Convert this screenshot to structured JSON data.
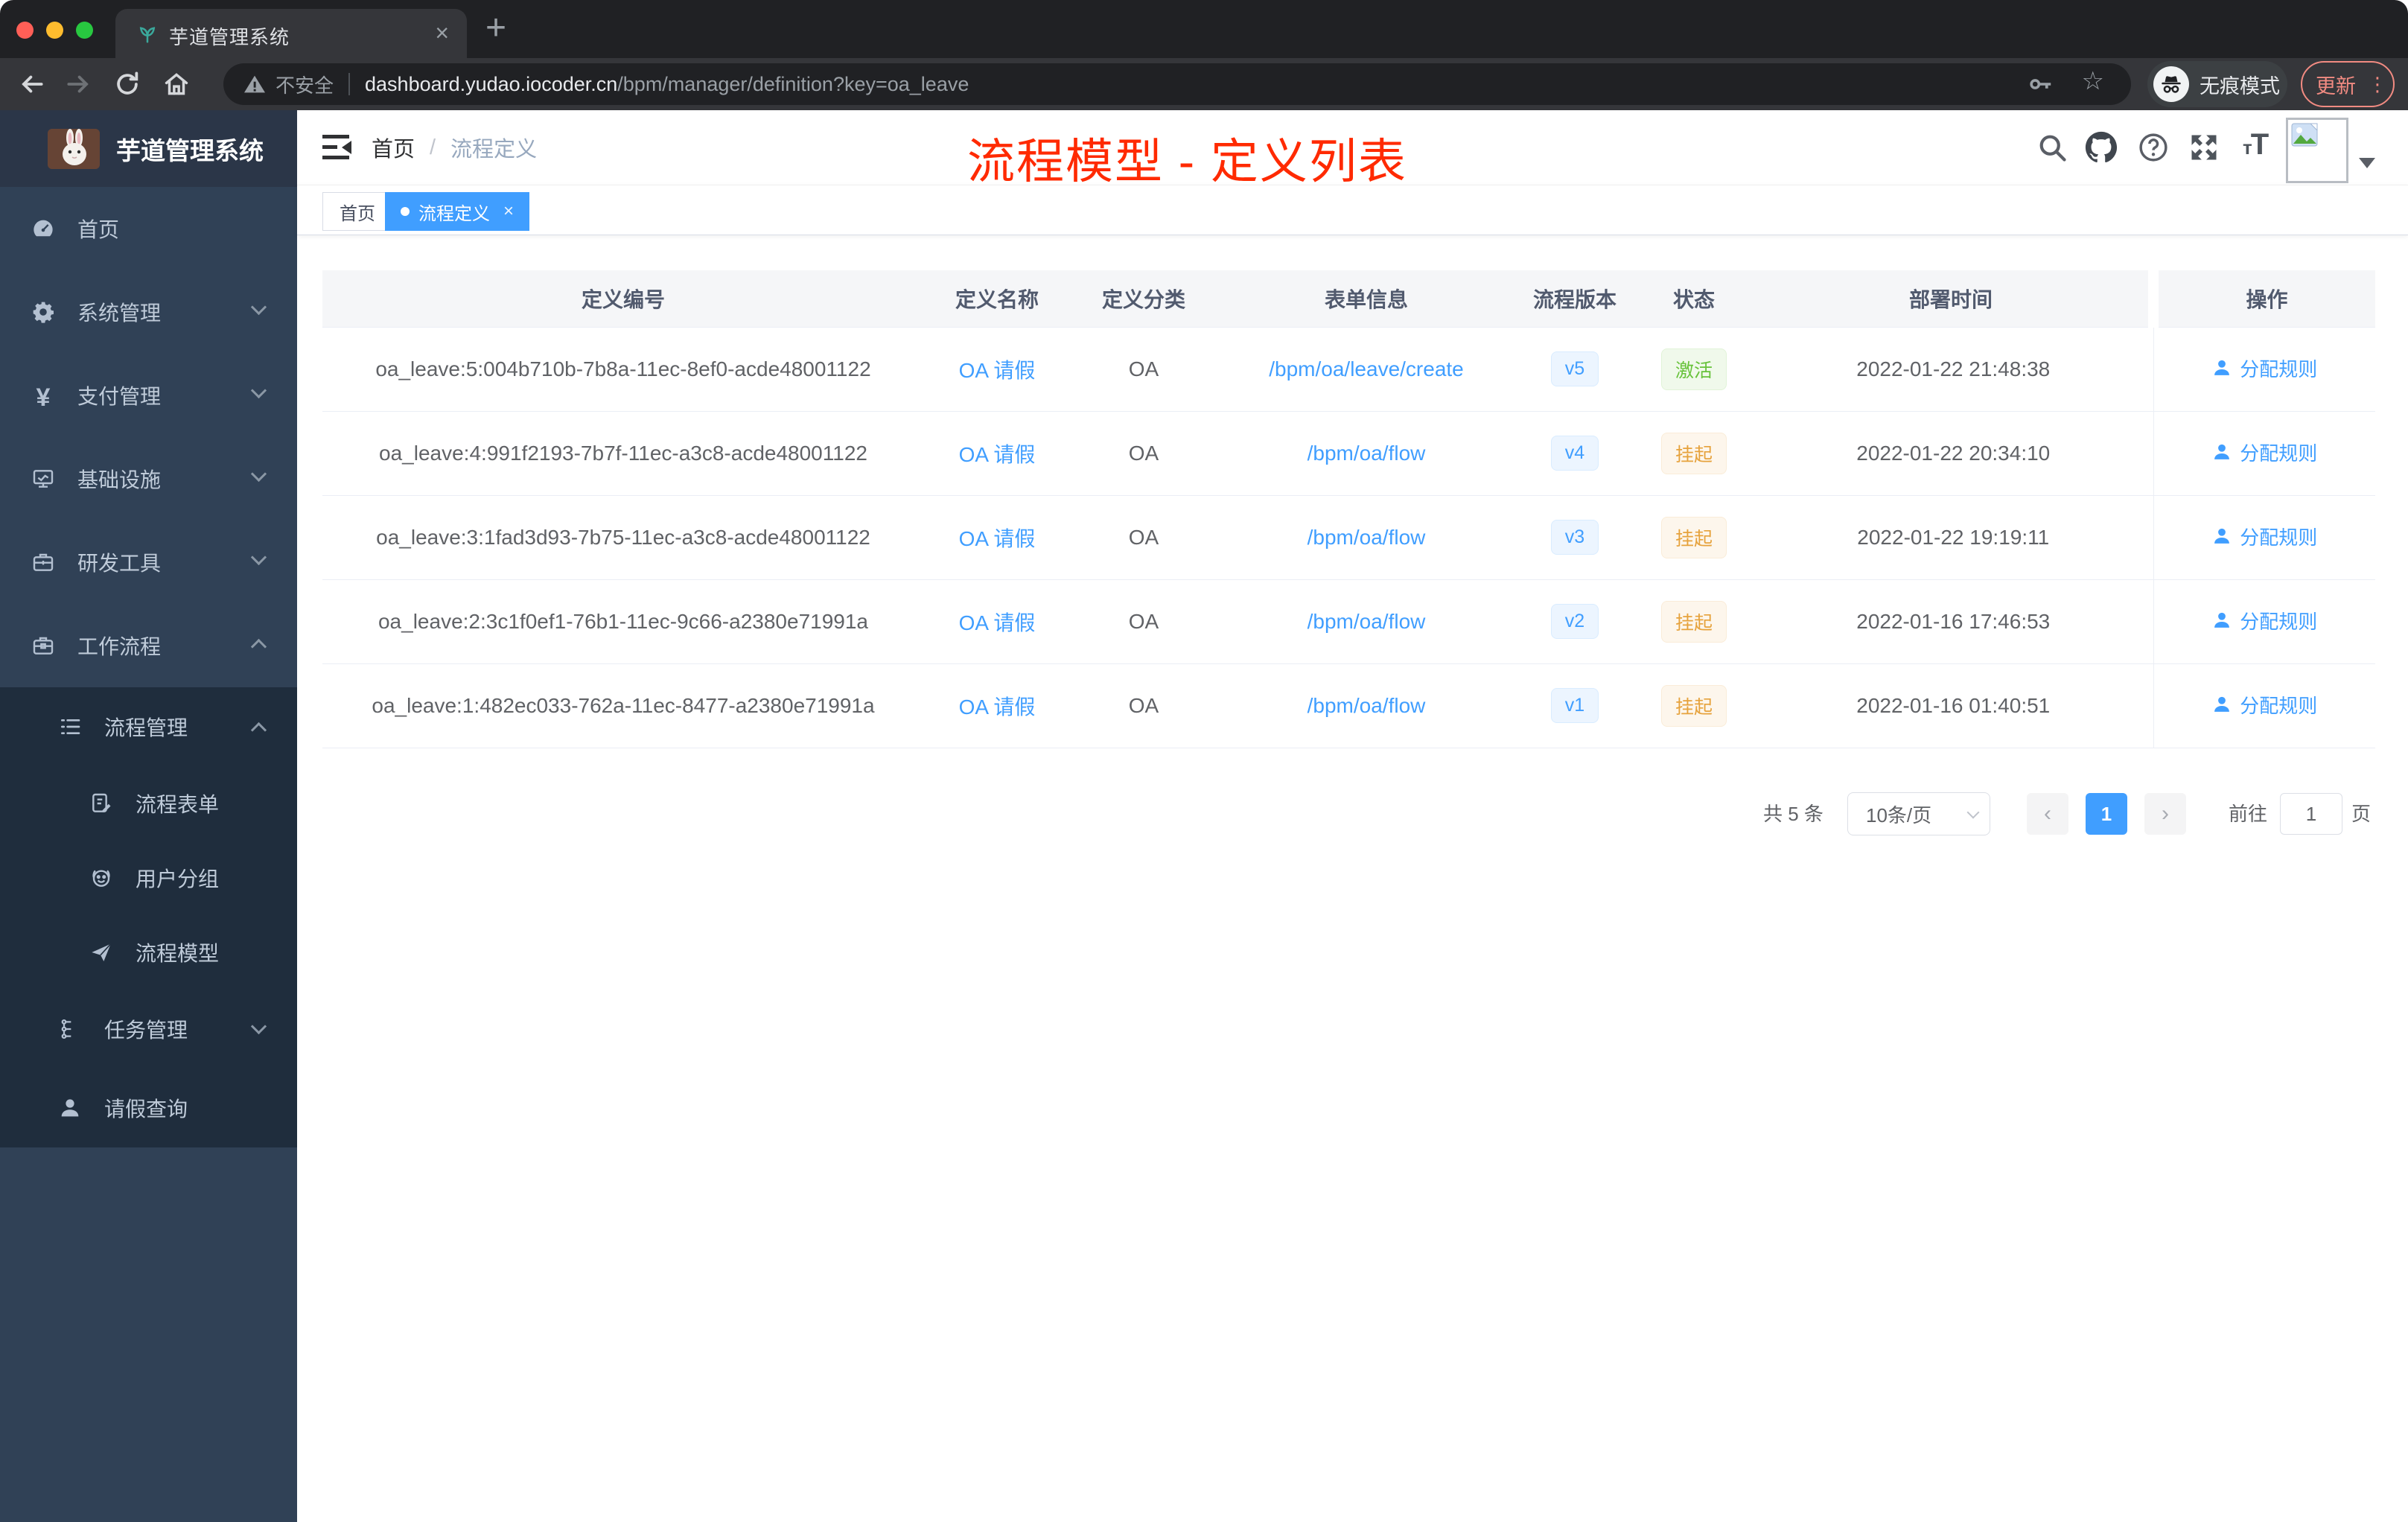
{
  "browser": {
    "tab_title": "芋道管理系统",
    "close_tab_glyph": "×",
    "new_tab_glyph": "+",
    "security_label": "不安全",
    "url_host": "dashboard.yudao.iocoder.cn",
    "url_path": "/bpm/manager/definition?key=oa_leave",
    "incognito_label": "无痕模式",
    "update_label": "更新",
    "menu_dots": "⋮",
    "star_glyph": "☆"
  },
  "sidebar": {
    "logo_title": "芋道管理系统",
    "menu": [
      {
        "label": "首页"
      },
      {
        "label": "系统管理"
      },
      {
        "label": "支付管理"
      },
      {
        "label": "基础设施"
      },
      {
        "label": "研发工具"
      },
      {
        "label": "工作流程"
      },
      {
        "label": "流程管理"
      },
      {
        "label": "流程表单"
      },
      {
        "label": "用户分组"
      },
      {
        "label": "流程模型"
      },
      {
        "label": "任务管理"
      },
      {
        "label": "请假查询"
      }
    ],
    "yen_glyph": "¥"
  },
  "header": {
    "breadcrumb_home": "首页",
    "breadcrumb_sep": "/",
    "breadcrumb_current": "流程定义",
    "annotation": "流程模型 - 定义列表",
    "annotation_color": "#ff2a00",
    "font_size_small": "т",
    "font_size_big": "T"
  },
  "tags": {
    "home": "首页",
    "active": "流程定义",
    "close_glyph": "×"
  },
  "table": {
    "columns": [
      "定义编号",
      "定义名称",
      "定义分类",
      "表单信息",
      "流程版本",
      "状态",
      "部署时间",
      "操作"
    ],
    "rows": [
      {
        "id": "oa_leave:5:004b710b-7b8a-11ec-8ef0-acde48001122",
        "name": "OA 请假",
        "category": "OA",
        "form": "/bpm/oa/leave/create",
        "version": "v5",
        "status": "激活",
        "status_type": "success",
        "deploy_time": "2022-01-22 21:48:38",
        "action": "分配规则"
      },
      {
        "id": "oa_leave:4:991f2193-7b7f-11ec-a3c8-acde48001122",
        "name": "OA 请假",
        "category": "OA",
        "form": "/bpm/oa/flow",
        "version": "v4",
        "status": "挂起",
        "status_type": "warning",
        "deploy_time": "2022-01-22 20:34:10",
        "action": "分配规则"
      },
      {
        "id": "oa_leave:3:1fad3d93-7b75-11ec-a3c8-acde48001122",
        "name": "OA 请假",
        "category": "OA",
        "form": "/bpm/oa/flow",
        "version": "v3",
        "status": "挂起",
        "status_type": "warning",
        "deploy_time": "2022-01-22 19:19:11",
        "action": "分配规则"
      },
      {
        "id": "oa_leave:2:3c1f0ef1-76b1-11ec-9c66-a2380e71991a",
        "name": "OA 请假",
        "category": "OA",
        "form": "/bpm/oa/flow",
        "version": "v2",
        "status": "挂起",
        "status_type": "warning",
        "deploy_time": "2022-01-16 17:46:53",
        "action": "分配规则"
      },
      {
        "id": "oa_leave:1:482ec033-762a-11ec-8477-a2380e71991a",
        "name": "OA 请假",
        "category": "OA",
        "form": "/bpm/oa/flow",
        "version": "v1",
        "status": "挂起",
        "status_type": "warning",
        "deploy_time": "2022-01-16 01:40:51",
        "action": "分配规则"
      }
    ]
  },
  "pagination": {
    "total_label": "共 5 条",
    "page_size": "10条/页",
    "prev_glyph": "‹",
    "next_glyph": "›",
    "current_page": "1",
    "goto_label": "前往",
    "goto_value": "1",
    "page_label": "页"
  },
  "colors": {
    "accent": "#409eff",
    "success": "#67c23a",
    "warning": "#e6a23c",
    "sidebar_bg": "#304156",
    "submenu_bg": "#1f2d3d",
    "annotation_red": "#ff2a00",
    "chrome_update": "#f28b82"
  }
}
